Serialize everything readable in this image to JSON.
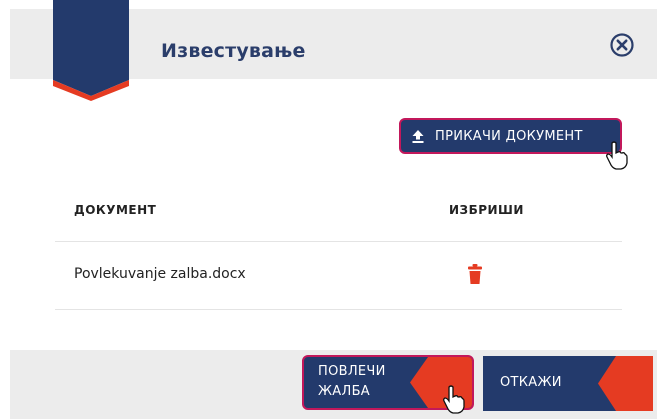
{
  "dialog": {
    "title": "Известување",
    "close_icon": "close-circle-icon"
  },
  "upload_button": {
    "label": "ПРИКАЧИ ДОКУМЕНТ",
    "icon": "upload-icon"
  },
  "table": {
    "headers": [
      "ДОКУМЕНТ",
      "ИЗБРИШИ"
    ],
    "rows": [
      {
        "document": "Povlekuvanje zalba.docx",
        "delete_icon": "trash-icon"
      }
    ]
  },
  "footer": {
    "withdraw_label": "ПОВЛЕЧИ ЖАЛБА",
    "cancel_label": "ОТКАЖИ"
  },
  "colors": {
    "navy": "#233a6c",
    "accent_red": "#e53b22",
    "highlight_border": "#c2185b",
    "panel_gray": "#ececec"
  }
}
